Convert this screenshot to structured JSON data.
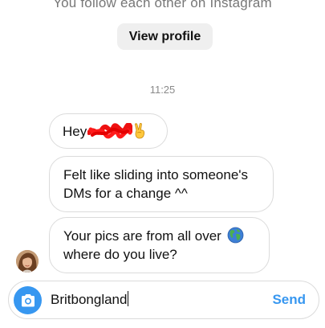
{
  "header": {
    "subtitle": "You follow each other on Instagram",
    "view_profile_label": "View profile"
  },
  "thread": {
    "timestamp": "11:25",
    "messages": [
      {
        "text_prefix": "Hey",
        "redacted_icon": "red-scribble-redaction",
        "emoji_icon": "victory-hand-emoji"
      },
      {
        "text": "Felt like sliding into someone's DMs for a change ^^"
      },
      {
        "text": "Your pics are from all over",
        "emoji_icon": "globe-emoji",
        "text2": "where do you live?"
      }
    ]
  },
  "composer": {
    "value": "Britbongland",
    "send_label": "Send",
    "camera_icon": "camera-icon",
    "accent": "#3797f0"
  }
}
